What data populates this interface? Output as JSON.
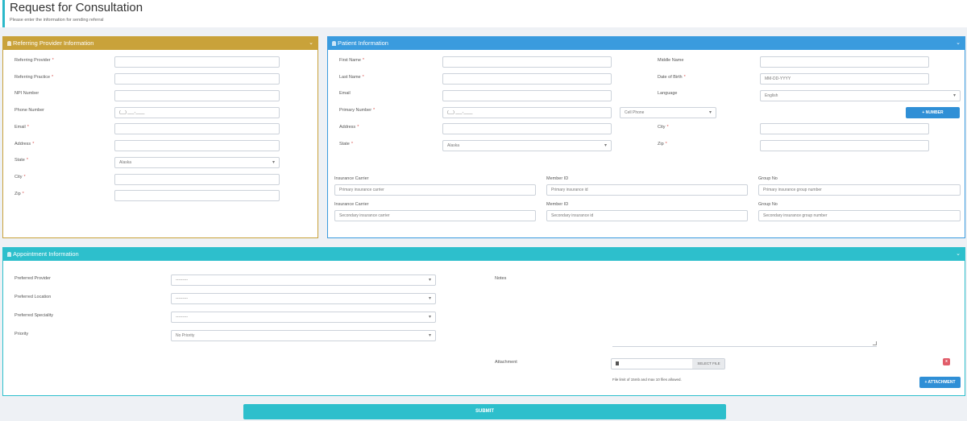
{
  "header": {
    "title": "Request for Consultation",
    "subtitle": "Please enter the information for sending referral"
  },
  "colors": {
    "provider_header": "#c9a23a",
    "patient_header": "#3a9bde",
    "appointment_header": "#2dbfcc",
    "submit": "#2dbfcc",
    "number_button": "#2f8fd6",
    "remove_button": "#e15d6a"
  },
  "provider": {
    "heading": "Referring Provider Information",
    "fields": [
      {
        "label": "Referring Provider",
        "required": "*",
        "value": ""
      },
      {
        "label": "Referring Practice",
        "required": "*",
        "value": ""
      },
      {
        "label": "NPI Number",
        "required": "",
        "value": ""
      },
      {
        "label": "Phone Number",
        "required": "",
        "value": "(__) ___-____"
      },
      {
        "label": "Email",
        "required": "*",
        "value": ""
      },
      {
        "label": "Address",
        "required": "*",
        "value": ""
      },
      {
        "label": "State",
        "required": "*",
        "value": "Alaska"
      },
      {
        "label": "City",
        "required": "*",
        "value": ""
      },
      {
        "label": "Zip",
        "required": "*",
        "value": ""
      }
    ]
  },
  "patient": {
    "heading": "Patient Information",
    "first_name": {
      "label": "First Name",
      "required": "*",
      "value": ""
    },
    "last_name": {
      "label": "Last Name",
      "required": "*",
      "value": ""
    },
    "email": {
      "label": "Email",
      "required": "",
      "value": ""
    },
    "primary_number": {
      "label": "Primary Number",
      "required": "*",
      "value": "(__) ___-____",
      "type": "Cell Phone"
    },
    "address": {
      "label": "Address",
      "required": "*",
      "value": ""
    },
    "state": {
      "label": "State",
      "required": "*",
      "value": "Alaska"
    },
    "middle_name": {
      "label": "Middle Name",
      "required": "",
      "value": ""
    },
    "dob": {
      "label": "Date of Birth",
      "required": "*",
      "placeholder": "MM-DD-YYYY"
    },
    "language": {
      "label": "Language",
      "required": "",
      "value": "English"
    },
    "number_button": "+ NUMBER",
    "city": {
      "label": "City",
      "required": "*",
      "value": ""
    },
    "zip": {
      "label": "Zip",
      "required": "*",
      "value": ""
    },
    "insurance": [
      {
        "carrier_label": "Insurance Carrier",
        "carrier_placeholder": "Primary insurance carrier",
        "member_label": "Member ID",
        "member_placeholder": "Primary insurance id",
        "group_label": "Group No",
        "group_placeholder": "Primary insurance group number"
      },
      {
        "carrier_label": "Insurance Carrier",
        "carrier_placeholder": "Secondary insurance carrier",
        "member_label": "Member ID",
        "member_placeholder": "Secondary insurance id",
        "group_label": "Group No",
        "group_placeholder": "Secondary insurance group number"
      }
    ]
  },
  "appointment": {
    "heading": "Appointment Information",
    "preferred_provider": {
      "label": "Preferred Provider",
      "value": "---------"
    },
    "preferred_location": {
      "label": "Preferred Location",
      "value": "---------"
    },
    "preferred_speciality": {
      "label": "Preferred Speciality",
      "value": "---------"
    },
    "priority": {
      "label": "Priority",
      "value": "No Priority"
    },
    "notes_label": "Notes",
    "attachment_label": "Attachment",
    "select_file": "SELECT FILE",
    "remove": "x",
    "file_hint": "File limit of 15mb and max 10 files allowed.",
    "attachment_button": "+ ATTACHMENT"
  },
  "submit_label": "SUBMIT"
}
